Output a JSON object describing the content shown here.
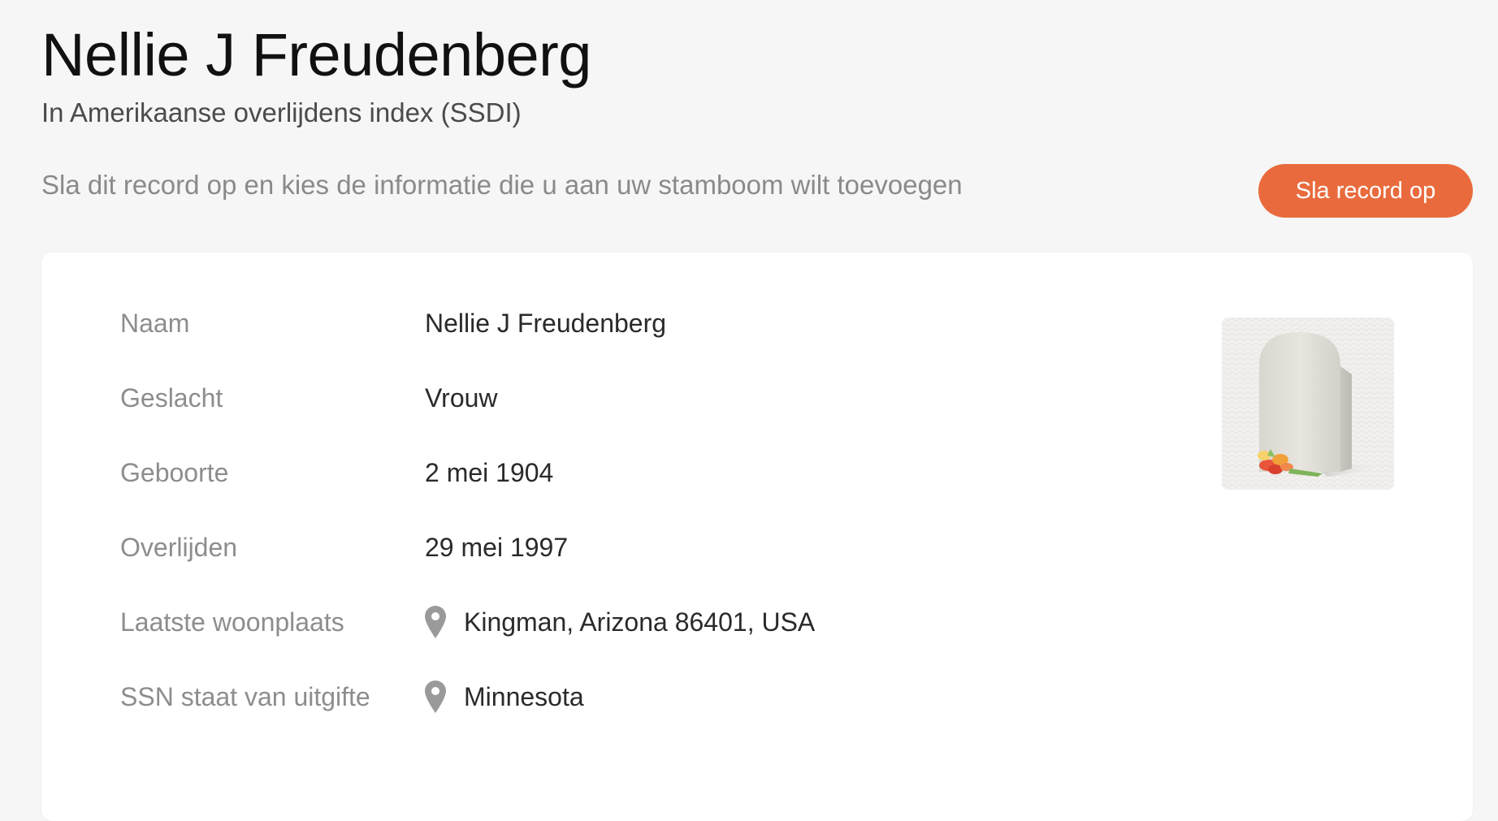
{
  "header": {
    "title": "Nellie J Freudenberg",
    "subtitle": "In Amerikaanse overlijdens index (SSDI)"
  },
  "action": {
    "prompt": "Sla dit record op en kies de informatie die u aan uw stamboom wilt toevoegen",
    "save_label": "Sla record op"
  },
  "record": {
    "fields": [
      {
        "label": "Naam",
        "value": "Nellie J Freudenberg"
      },
      {
        "label": "Geslacht",
        "value": "Vrouw"
      },
      {
        "label": "Geboorte",
        "value": "2 mei 1904"
      },
      {
        "label": "Overlijden",
        "value": "29 mei 1997"
      },
      {
        "label": "Laatste woonplaats",
        "value": "Kingman, Arizona 86401, USA",
        "icon": "location-pin-icon"
      },
      {
        "label": "SSN staat van uitgifte",
        "value": "Minnesota",
        "icon": "location-pin-icon"
      }
    ],
    "thumbnail": "gravestone-icon"
  },
  "colors": {
    "accent": "#e96b3d",
    "background": "#f6f6f6",
    "card": "#ffffff",
    "label": "#8d8d8d"
  }
}
